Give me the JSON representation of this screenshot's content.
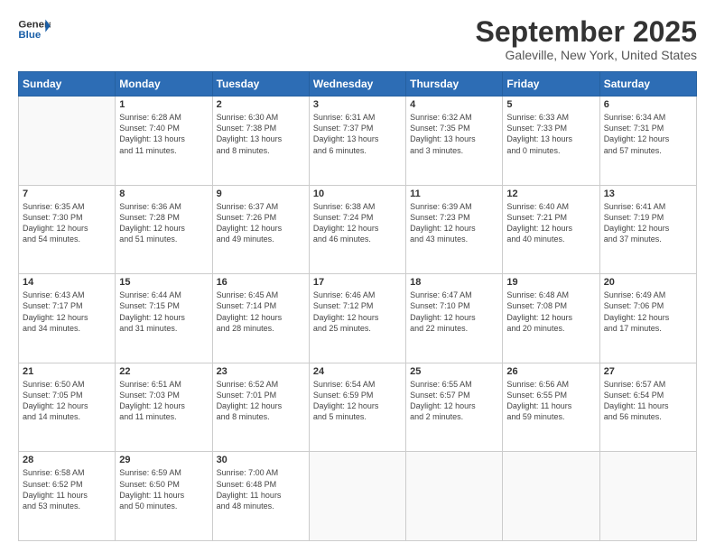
{
  "header": {
    "logo_line1": "General",
    "logo_line2": "Blue",
    "month_title": "September 2025",
    "location": "Galeville, New York, United States"
  },
  "weekdays": [
    "Sunday",
    "Monday",
    "Tuesday",
    "Wednesday",
    "Thursday",
    "Friday",
    "Saturday"
  ],
  "weeks": [
    [
      {
        "day": "",
        "info": ""
      },
      {
        "day": "1",
        "info": "Sunrise: 6:28 AM\nSunset: 7:40 PM\nDaylight: 13 hours\nand 11 minutes."
      },
      {
        "day": "2",
        "info": "Sunrise: 6:30 AM\nSunset: 7:38 PM\nDaylight: 13 hours\nand 8 minutes."
      },
      {
        "day": "3",
        "info": "Sunrise: 6:31 AM\nSunset: 7:37 PM\nDaylight: 13 hours\nand 6 minutes."
      },
      {
        "day": "4",
        "info": "Sunrise: 6:32 AM\nSunset: 7:35 PM\nDaylight: 13 hours\nand 3 minutes."
      },
      {
        "day": "5",
        "info": "Sunrise: 6:33 AM\nSunset: 7:33 PM\nDaylight: 13 hours\nand 0 minutes."
      },
      {
        "day": "6",
        "info": "Sunrise: 6:34 AM\nSunset: 7:31 PM\nDaylight: 12 hours\nand 57 minutes."
      }
    ],
    [
      {
        "day": "7",
        "info": "Sunrise: 6:35 AM\nSunset: 7:30 PM\nDaylight: 12 hours\nand 54 minutes."
      },
      {
        "day": "8",
        "info": "Sunrise: 6:36 AM\nSunset: 7:28 PM\nDaylight: 12 hours\nand 51 minutes."
      },
      {
        "day": "9",
        "info": "Sunrise: 6:37 AM\nSunset: 7:26 PM\nDaylight: 12 hours\nand 49 minutes."
      },
      {
        "day": "10",
        "info": "Sunrise: 6:38 AM\nSunset: 7:24 PM\nDaylight: 12 hours\nand 46 minutes."
      },
      {
        "day": "11",
        "info": "Sunrise: 6:39 AM\nSunset: 7:23 PM\nDaylight: 12 hours\nand 43 minutes."
      },
      {
        "day": "12",
        "info": "Sunrise: 6:40 AM\nSunset: 7:21 PM\nDaylight: 12 hours\nand 40 minutes."
      },
      {
        "day": "13",
        "info": "Sunrise: 6:41 AM\nSunset: 7:19 PM\nDaylight: 12 hours\nand 37 minutes."
      }
    ],
    [
      {
        "day": "14",
        "info": "Sunrise: 6:43 AM\nSunset: 7:17 PM\nDaylight: 12 hours\nand 34 minutes."
      },
      {
        "day": "15",
        "info": "Sunrise: 6:44 AM\nSunset: 7:15 PM\nDaylight: 12 hours\nand 31 minutes."
      },
      {
        "day": "16",
        "info": "Sunrise: 6:45 AM\nSunset: 7:14 PM\nDaylight: 12 hours\nand 28 minutes."
      },
      {
        "day": "17",
        "info": "Sunrise: 6:46 AM\nSunset: 7:12 PM\nDaylight: 12 hours\nand 25 minutes."
      },
      {
        "day": "18",
        "info": "Sunrise: 6:47 AM\nSunset: 7:10 PM\nDaylight: 12 hours\nand 22 minutes."
      },
      {
        "day": "19",
        "info": "Sunrise: 6:48 AM\nSunset: 7:08 PM\nDaylight: 12 hours\nand 20 minutes."
      },
      {
        "day": "20",
        "info": "Sunrise: 6:49 AM\nSunset: 7:06 PM\nDaylight: 12 hours\nand 17 minutes."
      }
    ],
    [
      {
        "day": "21",
        "info": "Sunrise: 6:50 AM\nSunset: 7:05 PM\nDaylight: 12 hours\nand 14 minutes."
      },
      {
        "day": "22",
        "info": "Sunrise: 6:51 AM\nSunset: 7:03 PM\nDaylight: 12 hours\nand 11 minutes."
      },
      {
        "day": "23",
        "info": "Sunrise: 6:52 AM\nSunset: 7:01 PM\nDaylight: 12 hours\nand 8 minutes."
      },
      {
        "day": "24",
        "info": "Sunrise: 6:54 AM\nSunset: 6:59 PM\nDaylight: 12 hours\nand 5 minutes."
      },
      {
        "day": "25",
        "info": "Sunrise: 6:55 AM\nSunset: 6:57 PM\nDaylight: 12 hours\nand 2 minutes."
      },
      {
        "day": "26",
        "info": "Sunrise: 6:56 AM\nSunset: 6:55 PM\nDaylight: 11 hours\nand 59 minutes."
      },
      {
        "day": "27",
        "info": "Sunrise: 6:57 AM\nSunset: 6:54 PM\nDaylight: 11 hours\nand 56 minutes."
      }
    ],
    [
      {
        "day": "28",
        "info": "Sunrise: 6:58 AM\nSunset: 6:52 PM\nDaylight: 11 hours\nand 53 minutes."
      },
      {
        "day": "29",
        "info": "Sunrise: 6:59 AM\nSunset: 6:50 PM\nDaylight: 11 hours\nand 50 minutes."
      },
      {
        "day": "30",
        "info": "Sunrise: 7:00 AM\nSunset: 6:48 PM\nDaylight: 11 hours\nand 48 minutes."
      },
      {
        "day": "",
        "info": ""
      },
      {
        "day": "",
        "info": ""
      },
      {
        "day": "",
        "info": ""
      },
      {
        "day": "",
        "info": ""
      }
    ]
  ]
}
